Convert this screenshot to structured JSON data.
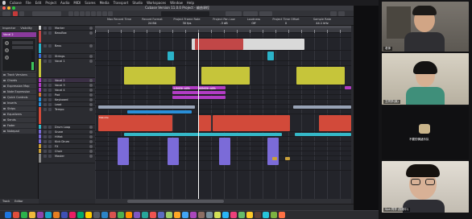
{
  "menubar": {
    "items": [
      "Cubase",
      "File",
      "Edit",
      "Project",
      "Audio",
      "MIDI",
      "Scores",
      "Media",
      "Transport",
      "Studio",
      "Workspaces",
      "Window",
      "Help"
    ],
    "status": "12:34"
  },
  "window": {
    "title": "Cubase Version 11.0.0 Project - 编曲课程",
    "infoline": [
      {
        "label": "Max Record Time",
        "value": "—"
      },
      {
        "label": "Record Format",
        "value": "24 Bit"
      },
      {
        "label": "Project Frame Rate",
        "value": "30 fps"
      },
      {
        "label": "Project Pan Law",
        "value": "-3 dB"
      },
      {
        "label": "Loudness",
        "value": "Off"
      },
      {
        "label": "Project Time Offset",
        "value": "0"
      },
      {
        "label": "Sample Rate",
        "value": "44.1 kHz"
      }
    ]
  },
  "inspector": {
    "tabs": [
      "Inspector",
      "Visibility"
    ],
    "track_name": "Vocal 2",
    "sections": [
      "Track Versions",
      "Chords",
      "Expression Map",
      "Note Expression",
      "Quick Controls",
      "Inserts",
      "Strips",
      "Equalizers",
      "Sends",
      "Fader",
      "Notepad"
    ],
    "footer_tabs": [
      "Track",
      "Editor"
    ]
  },
  "tracks": [
    {
      "name": "Marker",
      "color": "#d0d0d0"
    },
    {
      "name": "BassBox",
      "color": "#c14747"
    },
    {
      "name": "Bass",
      "color": "#2bb3c9"
    },
    {
      "name": "Strings",
      "color": "#3a6ad9"
    },
    {
      "name": "Vocal 1",
      "color": "#c6c53a"
    },
    {
      "name": "Vocal 2",
      "color": "#b23cc4"
    },
    {
      "name": "Vocal 3",
      "color": "#b23cc4"
    },
    {
      "name": "Vocal 4",
      "color": "#b23cc4"
    },
    {
      "name": "Pad",
      "color": "#cf7a3a"
    },
    {
      "name": "Keyboard",
      "color": "#2a8fd8"
    },
    {
      "name": "Lead",
      "color": "#2a8fd8"
    },
    {
      "name": "Tempo",
      "color": "#d24a3a"
    },
    {
      "name": "Drum Loop",
      "color": "#35b8c8"
    },
    {
      "name": "Snare",
      "color": "#7b6bd8"
    },
    {
      "name": "HiHat",
      "color": "#7b6bd8"
    },
    {
      "name": "Kick Drum",
      "color": "#7b6bd8"
    },
    {
      "name": "FX",
      "color": "#c9a03a"
    },
    {
      "name": "Choir",
      "color": "#c9a03a"
    },
    {
      "name": "Master",
      "color": "#888888"
    }
  ],
  "events": {
    "vocal_label": "主歌旋律 (编辑)",
    "vocal_label2": "副歌旋律 (编辑)",
    "lead_part": "Melodie"
  },
  "participants": [
    {
      "name": "老师",
      "hair": "#1c1a18"
    },
    {
      "name": "王同学(我)",
      "hair": "#141312"
    },
    {
      "name": "不要的情绪乐队",
      "hair": ""
    },
    {
      "name": "Spa 同学 (视频中)",
      "hair": "#15110e"
    }
  ],
  "dock": {
    "colors": [
      "#1e76e0",
      "#e04e3b",
      "#2bb24c",
      "#f0b83a",
      "#8e44ad",
      "#1aa3c4",
      "#e67e22",
      "#3f51b5",
      "#e91e63",
      "#00a86b",
      "#ffcc00",
      "#555b66",
      "#2c84c8",
      "#d9534f",
      "#4caf50",
      "#ff8f00",
      "#7e57c2",
      "#26a69a",
      "#ef5350",
      "#5c6bc0",
      "#9ccc65",
      "#ffa726",
      "#42a5f5",
      "#ab47bc",
      "#8d6e63",
      "#78909c",
      "#d4e157",
      "#29b6f6",
      "#ec407a",
      "#66bb6a",
      "#ffca28",
      "#5d4037",
      "#26c6da",
      "#7cb342",
      "#ff7043"
    ]
  }
}
